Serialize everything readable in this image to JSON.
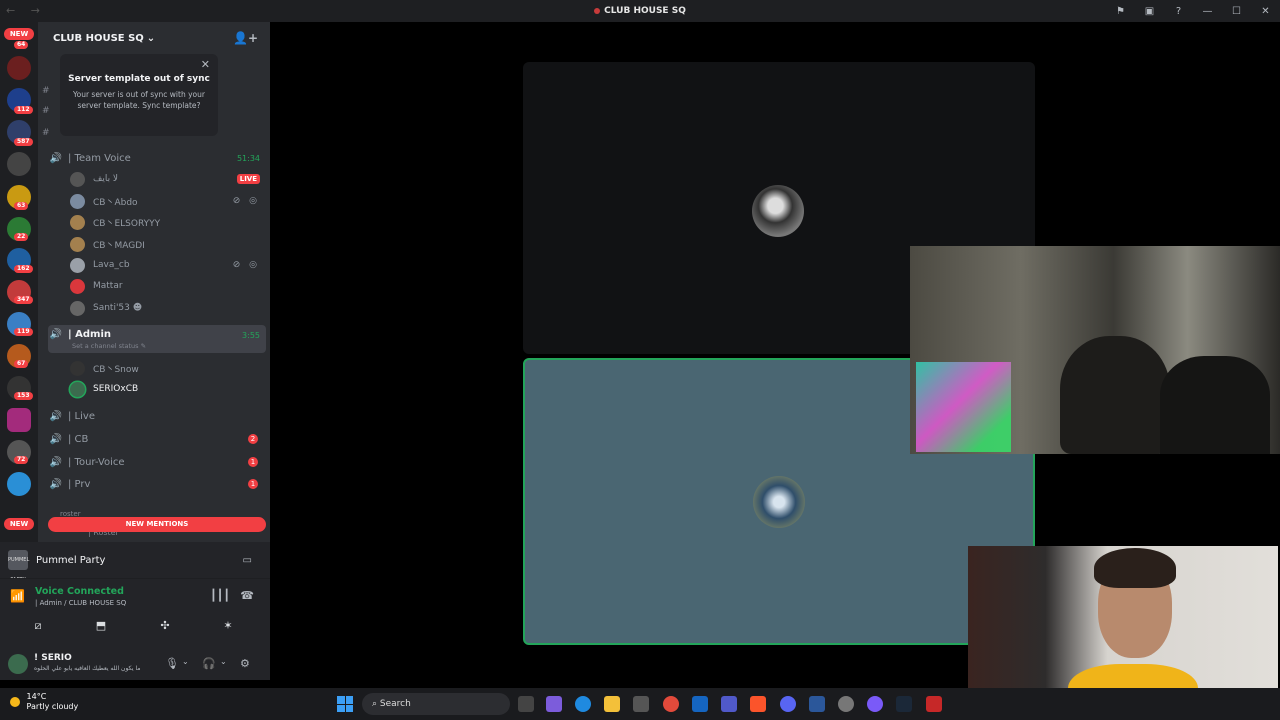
{
  "window": {
    "title": "CLUB HOUSE SQ",
    "nav_arrows": "← →",
    "controls": [
      "⚑",
      "▣",
      "?",
      "—",
      "☐",
      "✕"
    ]
  },
  "server_list": {
    "new_label_top": "NEW",
    "new_label_bottom": "NEW",
    "badges": [
      "64",
      "112",
      "587",
      "63",
      "22",
      "162",
      "347",
      "119",
      "67",
      "153",
      "72"
    ]
  },
  "server": {
    "name": "CLUB HOUSE SQ",
    "chevron": "⌄",
    "invite_icon": "👤+"
  },
  "template_popup": {
    "title": "Server template out of sync",
    "body": "Your server is out of sync with your server template. Sync template?",
    "close": "✕"
  },
  "channels": [
    {
      "name": "| Team Voice",
      "timer": "51:34"
    },
    {
      "name": "| Admin",
      "timer": "3:55",
      "status": "Set a channel status ✎"
    },
    {
      "name": "| Live"
    },
    {
      "name": "| CB",
      "count": "2"
    },
    {
      "name": "| Tour-Voice",
      "count": "1"
    },
    {
      "name": "| Prv",
      "count": "1"
    }
  ],
  "team_voice_users": [
    {
      "name": "لا بايف",
      "live": "LIVE"
    },
    {
      "name": "CB丶Abdo",
      "icons": "⊘ ◎"
    },
    {
      "name": "CB丶ELSORYYY"
    },
    {
      "name": "CB丶MAGDI"
    },
    {
      "name": "Lava_cb",
      "icons": "⊘ ◎"
    },
    {
      "name": "Mattar"
    },
    {
      "name": "Santi'53 ☻"
    }
  ],
  "admin_users": [
    {
      "name": "CB丶Snow"
    },
    {
      "name": "SERIOxCB"
    }
  ],
  "truncated_rows": [
    "roster",
    "| Roster"
  ],
  "new_mentions": "NEW MENTIONS",
  "activity": {
    "game": "Pummel Party",
    "logo_text": "PUMMEL PARTY"
  },
  "voice_panel": {
    "status": "Voice Connected",
    "location": "| Admin / CLUB HOUSE SQ"
  },
  "current_user": {
    "name": "! SERIO",
    "status": "ما يكون الله يعطيك العافيه يابو علي الحلوه"
  },
  "taskbar": {
    "temperature": "14°C",
    "weather": "Partly cloudy",
    "search": "Search"
  },
  "colors": {
    "green": "#23a55a",
    "red": "#f23f43",
    "sidebar": "#2b2d31",
    "tile_highlight": "#4a6672"
  }
}
